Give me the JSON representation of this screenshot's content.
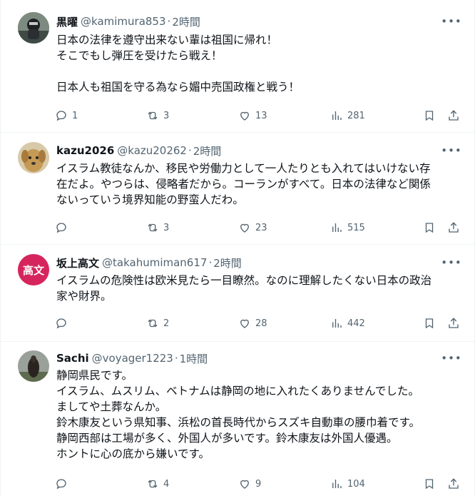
{
  "tweets": [
    {
      "name": "黒曜",
      "handle": "@kamimura853",
      "separator": "·",
      "time": "2時間",
      "lines": [
        "日本の法律を遵守出来ない輩は祖国に帰れ！",
        "そこでもし弾圧を受けたら戦え！",
        "",
        "日本人も祖国を守る為なら媚中売国政権と戦う！"
      ],
      "replies": "1",
      "reposts": "3",
      "likes": "13",
      "views": "281",
      "avatar": {
        "type": "photo",
        "bg": "#6f7b73"
      }
    },
    {
      "name": "kazu2026",
      "handle": "@kazu20262",
      "separator": "·",
      "time": "2時間",
      "lines": [
        "イスラム教徒なんか、移民や労働力として一人たりとも入れてはいけない存",
        "在だよ。やつらは、侵略者だから。コーランがすべて。日本の法律など関係",
        "ないっていう境界知能の野蛮人だわ。"
      ],
      "replies": "",
      "reposts": "3",
      "likes": "23",
      "views": "515",
      "avatar": {
        "type": "photo",
        "bg": "#c9a46a"
      }
    },
    {
      "name": "坂上高文",
      "handle": "@takahumiman617",
      "separator": "·",
      "time": "2時間",
      "lines": [
        "イスラムの危険性は欧米見たら一目瞭然。なのに理解したくない日本の政治",
        "家や財界。"
      ],
      "replies": "",
      "reposts": "2",
      "likes": "28",
      "views": "442",
      "avatar": {
        "type": "text",
        "text": "高文",
        "bg": "#d6255d"
      }
    },
    {
      "name": "Sachi",
      "handle": "@voyager1223",
      "separator": "·",
      "time": "1時間",
      "lines": [
        "静岡県民です。",
        "イスラム、ムスリム、ベトナムは静岡の地に入れたくありませんでした。",
        "ましてや土葬なんか。",
        "鈴木康友という県知事、浜松の首長時代からスズキ自動車の腰巾着です。",
        "静岡西部は工場が多く、外国人が多いです。鈴木康友は外国人優遇。",
        "ホントに心の底から嫌いです。"
      ],
      "replies": "",
      "reposts": "4",
      "likes": "9",
      "views": "104",
      "avatar": {
        "type": "photo",
        "bg": "#4c4f4a"
      }
    }
  ],
  "more_label": "•••",
  "icons": [
    "reply-icon",
    "repost-icon",
    "like-icon",
    "views-icon",
    "bookmark-icon",
    "share-icon"
  ]
}
